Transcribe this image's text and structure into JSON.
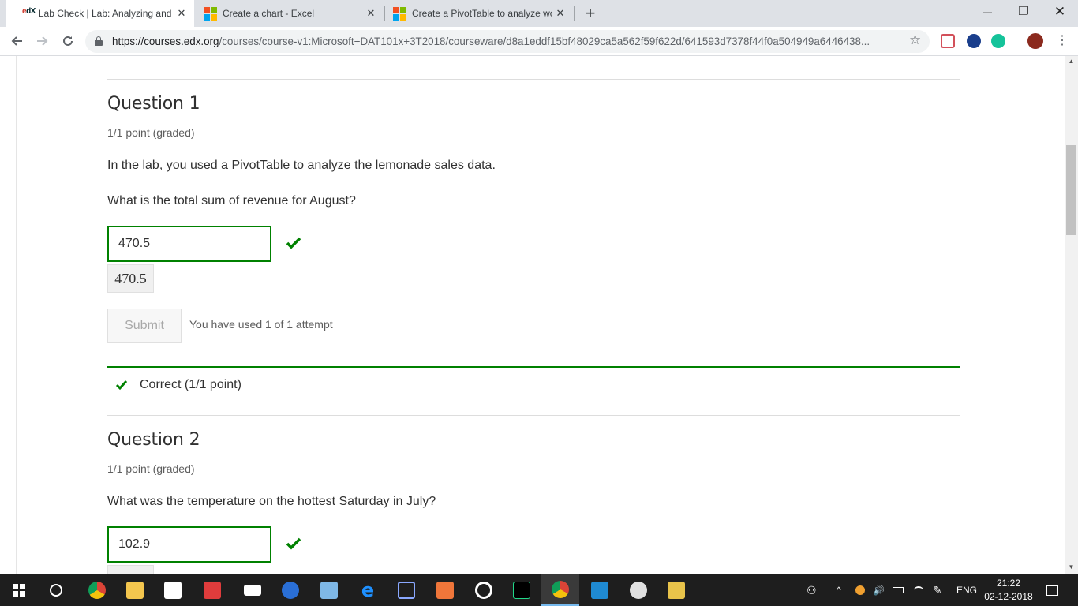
{
  "browser": {
    "tabs": [
      {
        "title": "Lab Check | Lab: Analyzing and V",
        "icon": "edx-logo",
        "logo_text": "edX",
        "active": true
      },
      {
        "title": "Create a chart - Excel",
        "icon": "microsoft-logo",
        "active": false
      },
      {
        "title": "Create a PivotTable to analyze wo",
        "icon": "microsoft-logo",
        "active": false
      }
    ],
    "new_tab_symbol": "+",
    "close_symbol": "✕",
    "window": {
      "minimize": "—",
      "restore": "❐",
      "close": "✕"
    },
    "url_host": "https://courses.edx.org",
    "url_path": "/courses/course-v1:Microsoft+DAT101x+3T2018/courseware/d8a1eddf15bf48029ca5a562f59f622d/641593d7378f44f0a504949a6446438...",
    "accent_color": "#008100"
  },
  "question1": {
    "title": "Question 1",
    "points": "1/1 point (graded)",
    "prompt1": "In the lab, you used a PivotTable to analyze the lemonade sales data.",
    "prompt2": "What is the total sum of revenue for August?",
    "answer": "470.5",
    "preview": "470.5",
    "submit_label": "Submit",
    "attempts": "You have used 1 of 1 attempt",
    "result": "Correct (1/1 point)"
  },
  "question2": {
    "title": "Question 2",
    "points": "1/1 point (graded)",
    "prompt": "What was the temperature on the hottest Saturday in July?",
    "answer": "102.9"
  },
  "taskbar": {
    "language": "ENG",
    "time": "21:22",
    "date": "02-12-2018"
  }
}
